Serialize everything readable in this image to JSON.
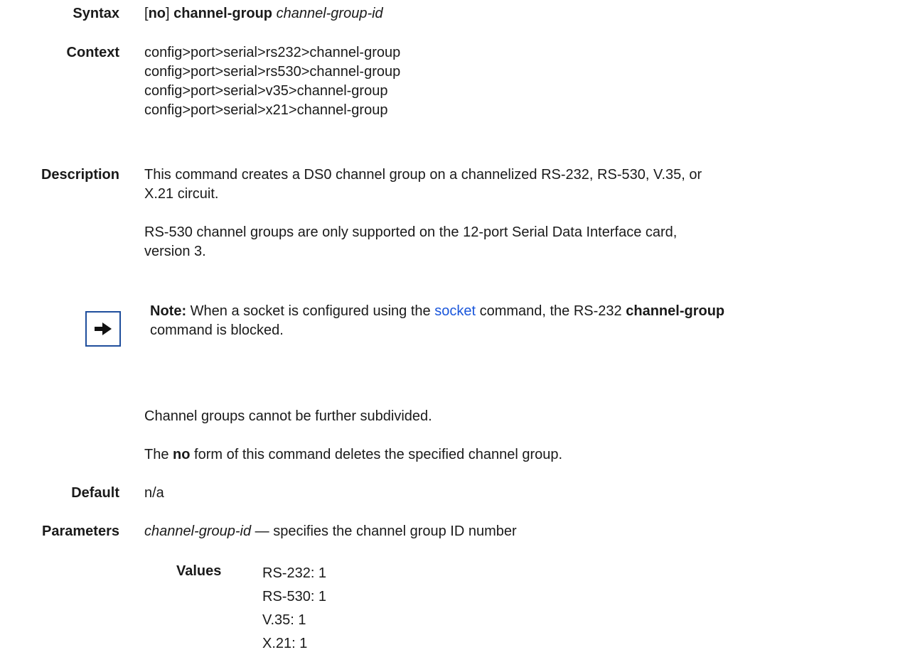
{
  "syntax": {
    "label": "Syntax",
    "open_bracket": "[",
    "no": "no",
    "close_bracket": "]",
    "command": "channel-group",
    "param": "channel-group-id"
  },
  "context": {
    "label": "Context",
    "lines": [
      "config>port>serial>rs232>channel-group",
      "config>port>serial>rs530>channel-group",
      "config>port>serial>v35>channel-group",
      "config>port>serial>x21>channel-group"
    ]
  },
  "description": {
    "label": "Description",
    "para1_line1": "This command creates a DS0 channel group on a channelized RS-232, RS-530, V.35, or",
    "para1_line2": "X.21 circuit.",
    "para2_line1": "RS-530 channel groups are only supported on the 12-port Serial Data Interface card,",
    "para2_line2": "version 3."
  },
  "note": {
    "icon": "arrow-right-icon",
    "label": "Note:",
    "text_a": "When a socket is configured using the",
    "link": "socket",
    "text_b": "command, the RS-232",
    "bold": "channel-group",
    "text_c": "command is blocked."
  },
  "after_note": {
    "para1": "Channel groups cannot be further subdivided.",
    "para2_pre": "The",
    "para2_bold": "no",
    "para2_post": "form of this command deletes the specified channel group."
  },
  "default": {
    "label": "Default",
    "value": "n/a"
  },
  "parameters": {
    "label": "Parameters",
    "param": "channel-group-id",
    "dash": "—",
    "desc": "specifies the channel group ID number",
    "values_label": "Values",
    "values": [
      "RS-232: 1",
      "RS-530: 1",
      "V.35: 1",
      "X.21: 1"
    ]
  },
  "colors": {
    "link": "#1a56db",
    "icon_border": "#1f4e9c"
  }
}
